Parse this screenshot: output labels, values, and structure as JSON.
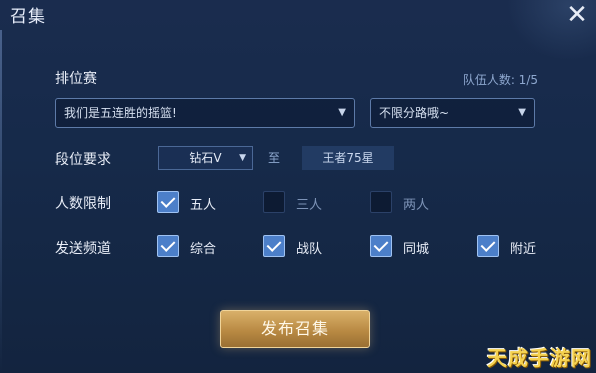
{
  "window": {
    "title": "召集"
  },
  "match": {
    "label": "排位赛",
    "team_count": "队伍人数: 1/5",
    "slogan_value": "我们是五连胜的摇篮!",
    "lane_value": "不限分路哦~"
  },
  "rank": {
    "label": "段位要求",
    "from": "钻石V",
    "separator": "至",
    "to": "王者75星"
  },
  "people": {
    "label": "人数限制",
    "options": [
      {
        "label": "五人",
        "checked": true
      },
      {
        "label": "三人",
        "checked": false
      },
      {
        "label": "两人",
        "checked": false
      }
    ]
  },
  "channel": {
    "label": "发送频道",
    "options": [
      {
        "label": "综合",
        "checked": true
      },
      {
        "label": "战队",
        "checked": true
      },
      {
        "label": "同城",
        "checked": true
      },
      {
        "label": "附近",
        "checked": true
      }
    ]
  },
  "publish_label": "发布召集",
  "watermark": "天成手游网",
  "icons": {
    "close": "close-icon",
    "dropdown": "chevron-down-icon",
    "check": "checkmark-icon"
  }
}
